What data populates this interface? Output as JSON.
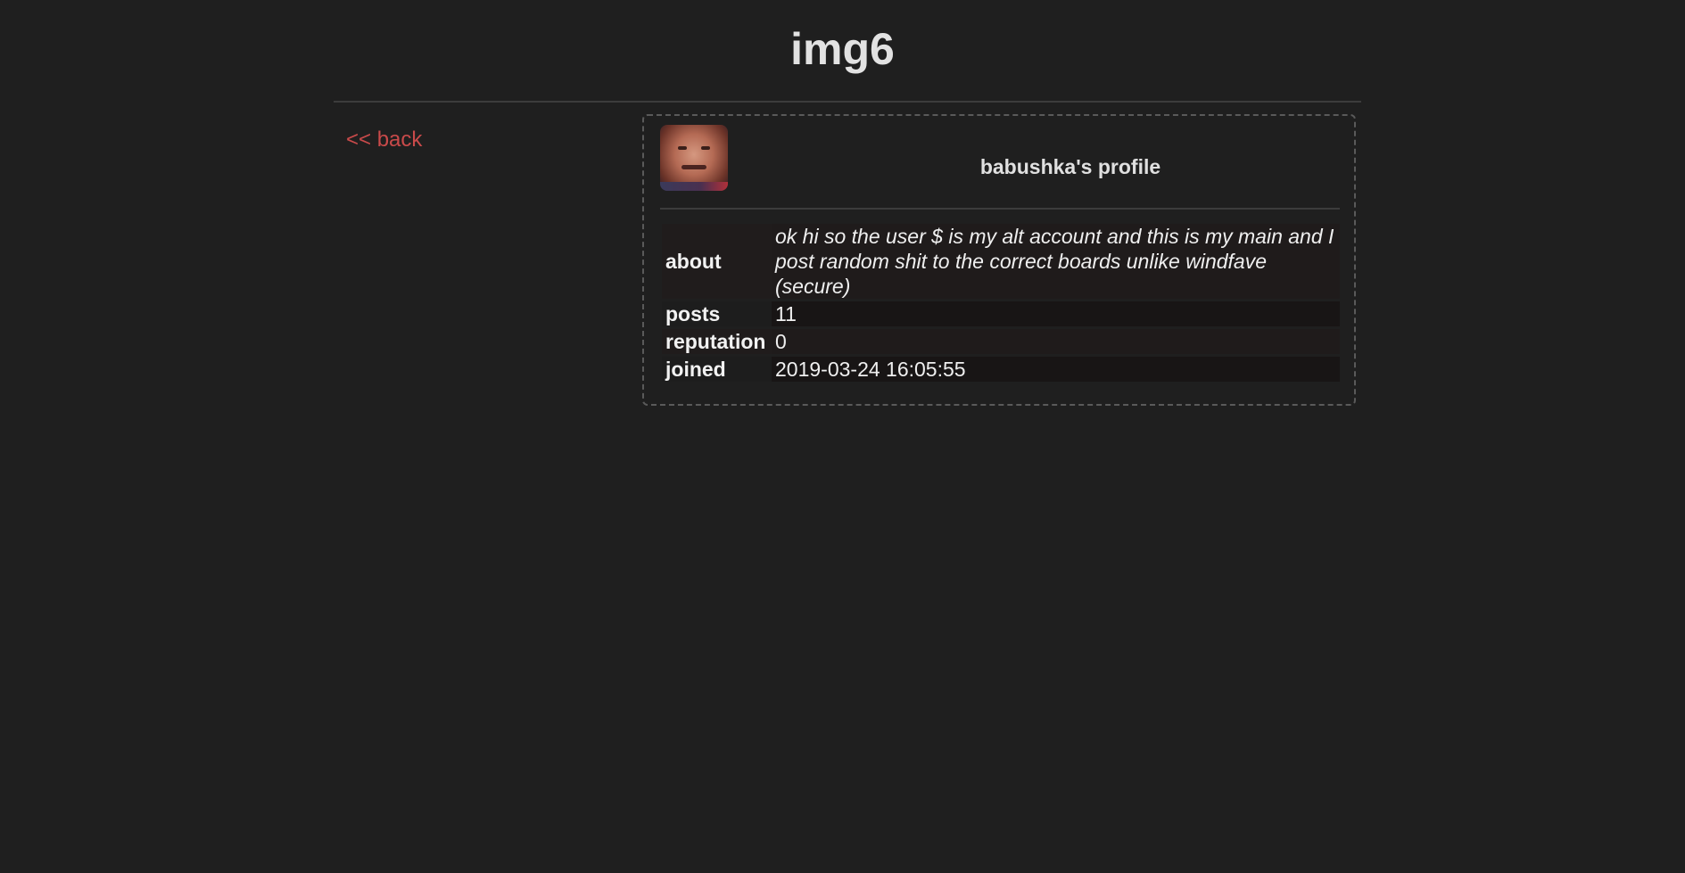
{
  "header": {
    "title": "img6"
  },
  "nav": {
    "back_label": "<< back"
  },
  "profile": {
    "heading": "babushka's profile",
    "fields": {
      "about_label": "about",
      "about_value": "ok hi so the user $ is my alt account and this is my main and I post random shit to the correct boards unlike windfave (secure)",
      "posts_label": "posts",
      "posts_value": "11",
      "reputation_label": "reputation",
      "reputation_value": "0",
      "joined_label": "joined",
      "joined_value": "2019-03-24 16:05:55"
    }
  },
  "colors": {
    "background": "#1f1f1f",
    "link": "#c94a4a",
    "border": "#5a5a5a"
  }
}
